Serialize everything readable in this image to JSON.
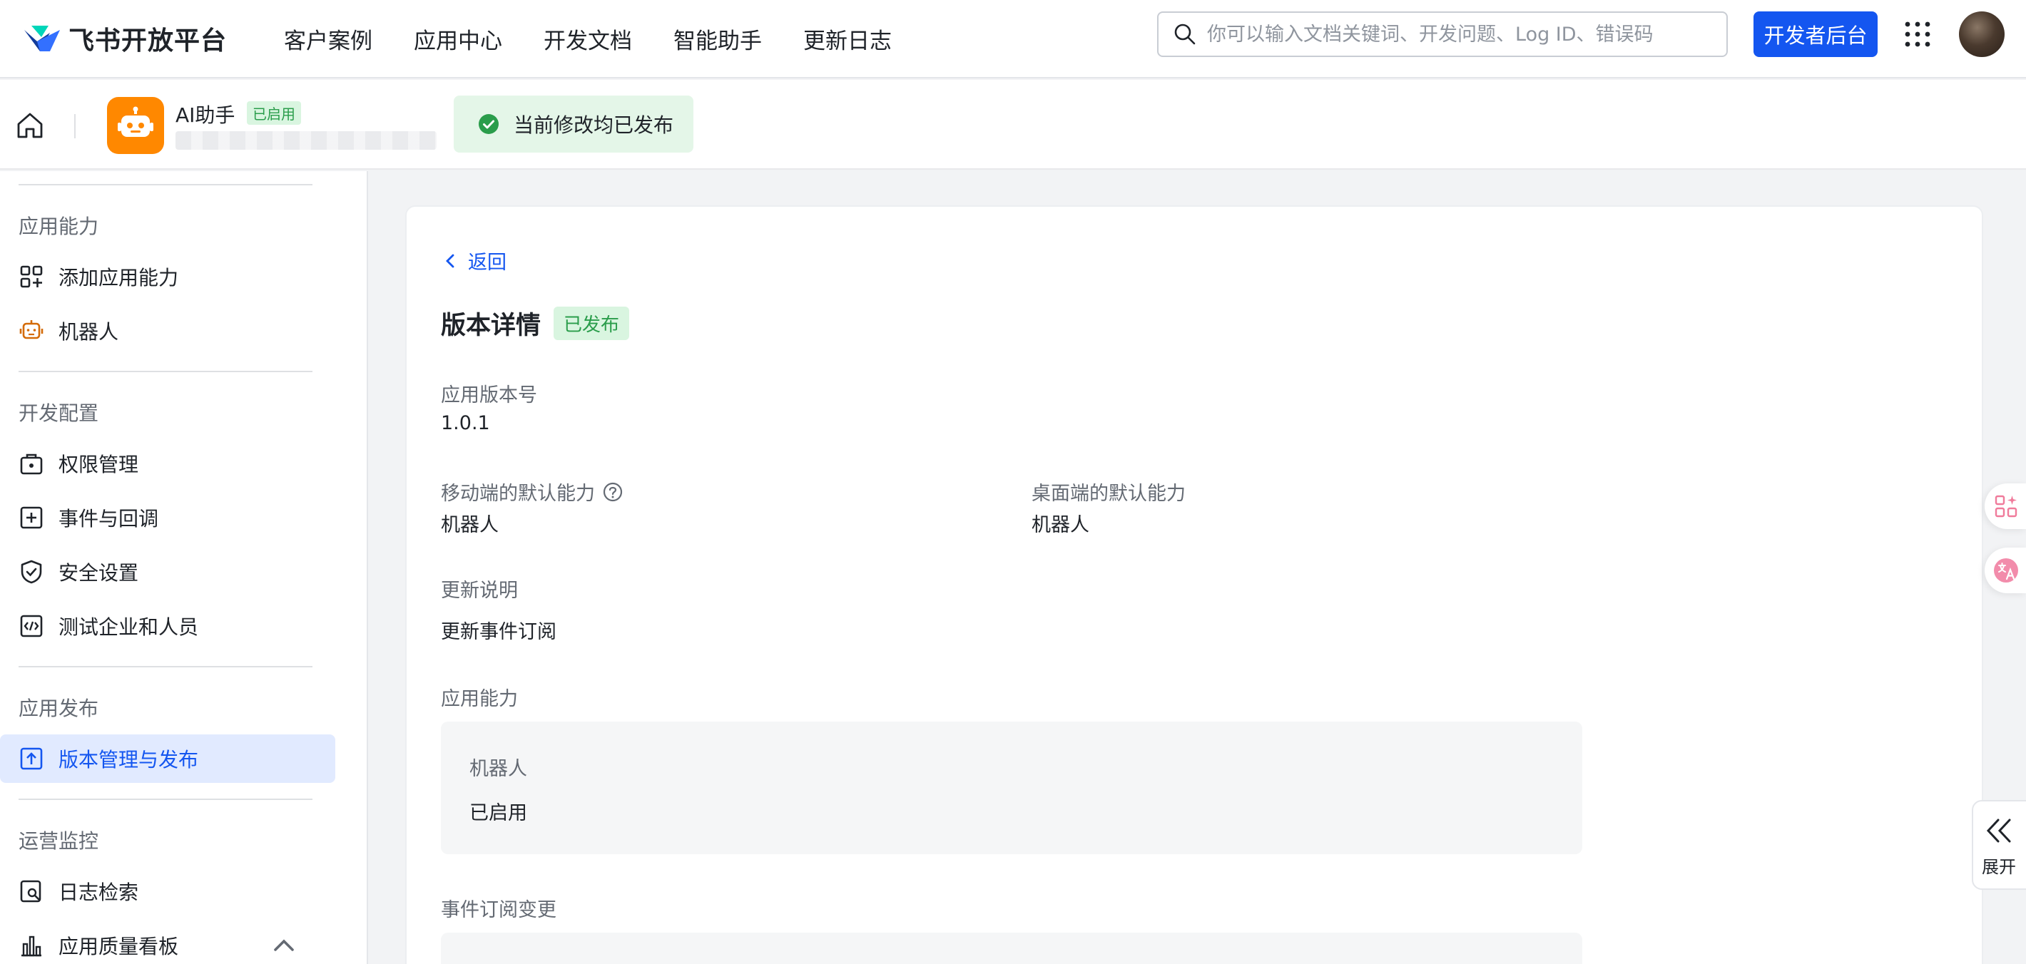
{
  "nav": {
    "brand": "飞书开放平台",
    "links": [
      "客户案例",
      "应用中心",
      "开发文档",
      "智能助手",
      "更新日志"
    ],
    "search_placeholder": "你可以输入文档关键词、开发问题、Log ID、错误码",
    "dev_console": "开发者后台"
  },
  "app": {
    "name": "AI助手",
    "status": "已启用",
    "toast": "当前修改均已发布"
  },
  "sidebar": {
    "sections": [
      {
        "title": "应用能力",
        "items": [
          "添加应用能力",
          "机器人"
        ]
      },
      {
        "title": "开发配置",
        "items": [
          "权限管理",
          "事件与回调",
          "安全设置",
          "测试企业和人员"
        ]
      },
      {
        "title": "应用发布",
        "items": [
          "版本管理与发布"
        ]
      },
      {
        "title": "运营监控",
        "items": [
          "日志检索",
          "应用质量看板"
        ]
      }
    ],
    "active": "版本管理与发布"
  },
  "detail": {
    "back": "返回",
    "title": "版本详情",
    "status": "已发布",
    "version_label": "应用版本号",
    "version": "1.0.1",
    "mobile_label": "移动端的默认能力",
    "mobile_value": "机器人",
    "desktop_label": "桌面端的默认能力",
    "desktop_value": "机器人",
    "notes_label": "更新说明",
    "notes": "更新事件订阅",
    "capability_label": "应用能力",
    "capability_name": "机器人",
    "capability_status": "已启用",
    "events_label": "事件订阅变更"
  },
  "float": {
    "expand": "展开"
  },
  "colors": {
    "primary": "#1456f0",
    "success": "#2a9d4b",
    "app_icon": "#ff8800"
  }
}
